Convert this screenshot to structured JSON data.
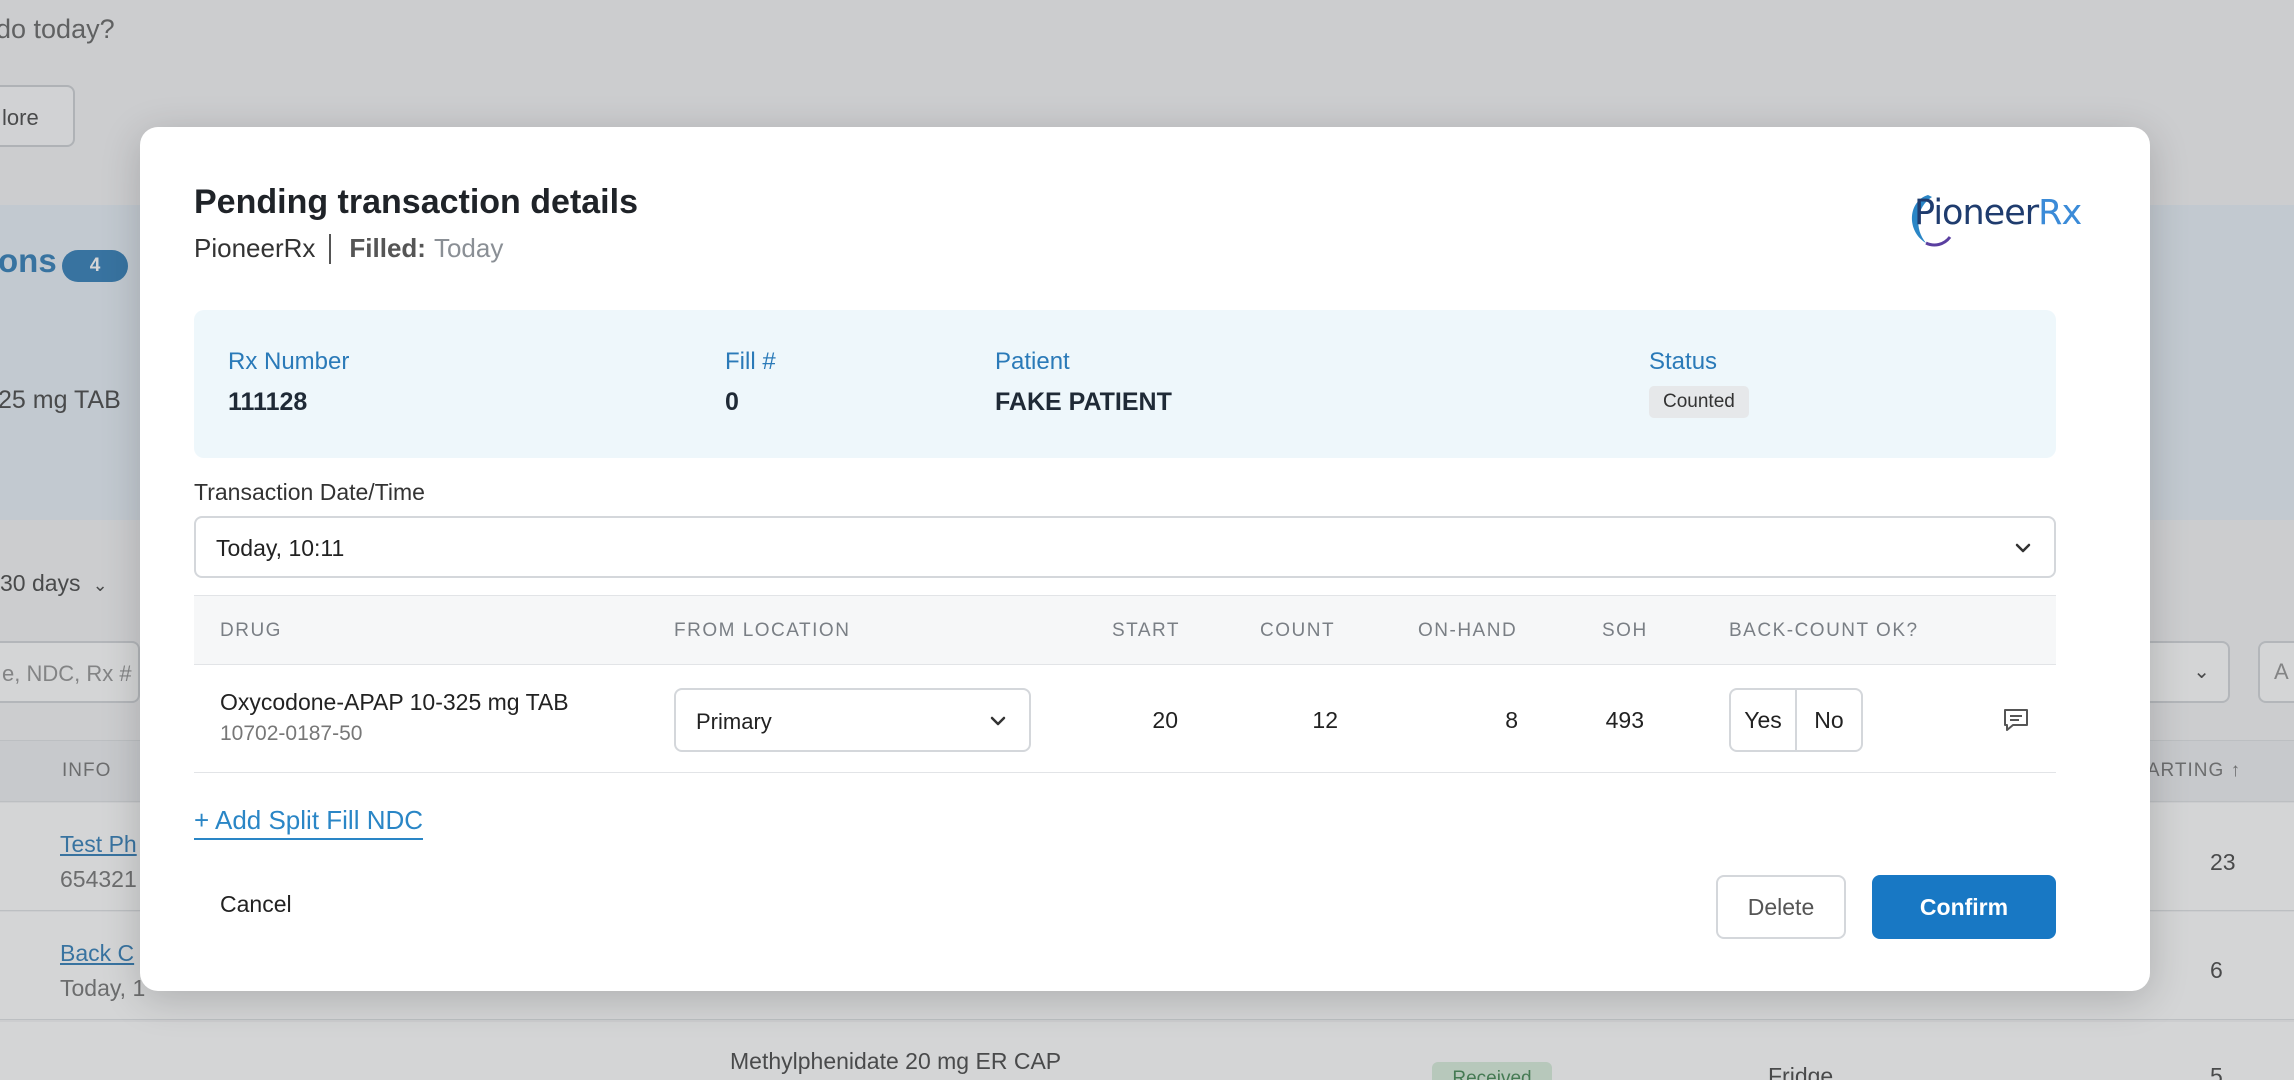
{
  "background": {
    "greeting": "do today?",
    "more_button": "lore",
    "section_title": "ons",
    "section_count": "4",
    "drug_text": "25 mg TAB",
    "days_filter": "30 days",
    "search_placeholder": "e, NDC, Rx #",
    "right_input": "A",
    "col_info": "INFO",
    "col_starting": "STARTING ↑",
    "rows": [
      {
        "link": "Test Ph",
        "sub": "654321",
        "starting": "23"
      },
      {
        "link": "Back C",
        "sub": "Today, 1",
        "starting": "6"
      },
      {
        "drug": "Methylphenidate 20 mg ER CAP",
        "status": "Received",
        "location": "Fridge",
        "starting": "5"
      }
    ]
  },
  "modal": {
    "title": "Pending transaction details",
    "source": "PioneerRx",
    "filled_label": "Filled:",
    "filled_value": "Today",
    "logo": {
      "main": "Pioneer",
      "suffix": "Rx"
    },
    "info": {
      "rx_number_label": "Rx Number",
      "rx_number": "111128",
      "fill_label": "Fill #",
      "fill": "0",
      "patient_label": "Patient",
      "patient": "FAKE PATIENT",
      "status_label": "Status",
      "status": "Counted"
    },
    "transaction": {
      "label": "Transaction Date/Time",
      "value": "Today, 10:11"
    },
    "table": {
      "headers": {
        "drug": "DRUG",
        "from_location": "FROM LOCATION",
        "start": "START",
        "count": "COUNT",
        "on_hand": "ON-HAND",
        "soh": "SOH",
        "back_count": "BACK-COUNT OK?"
      },
      "row": {
        "drug_name": "Oxycodone-APAP 10-325 mg TAB",
        "ndc": "10702-0187-50",
        "location": "Primary",
        "start": "20",
        "count": "12",
        "on_hand": "8",
        "soh": "493",
        "yes": "Yes",
        "no": "No"
      }
    },
    "add_split": "+ Add Split Fill NDC",
    "cancel": "Cancel",
    "delete": "Delete",
    "confirm": "Confirm"
  },
  "colors": {
    "accent": "#1878c4",
    "panel_bg": "#eef7fb",
    "label_blue": "#2a7ab8"
  },
  "icons": [
    "chevron-down-icon",
    "comment-icon"
  ]
}
